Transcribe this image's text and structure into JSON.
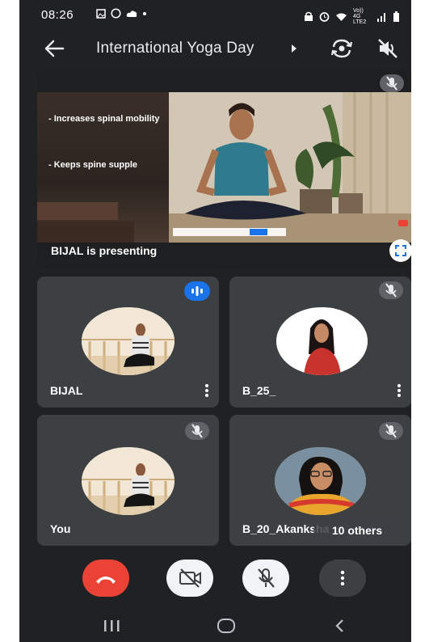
{
  "status_bar": {
    "time": "08:26",
    "network": "Vo)) 4G LTE2"
  },
  "meeting": {
    "title": "International  Yoga Day"
  },
  "presentation": {
    "slide_points": [
      "- Increases spinal mobility",
      "- Keeps spine supple"
    ],
    "presenting_label": "BIJAL is presenting"
  },
  "participants": [
    {
      "name": "BIJAL",
      "status": "speaking"
    },
    {
      "name": "B_25_",
      "status": "muted"
    },
    {
      "name": "You",
      "status": "muted"
    },
    {
      "name": "B_20_Akanksha",
      "status": "muted"
    }
  ],
  "others_label": "10 others",
  "icons": [
    "back-arrow-icon",
    "switch-camera-icon",
    "speaker-off-icon",
    "mic-off-icon",
    "fullscreen-icon",
    "audio-wave-icon",
    "more-vert-icon",
    "end-call-icon",
    "camera-off-icon",
    "recents-icon",
    "home-icon",
    "nav-back-icon"
  ],
  "colors": {
    "background": "#202124",
    "tile": "#3c4043",
    "end_call": "#ea4335",
    "speaking": "#1a73e8"
  }
}
